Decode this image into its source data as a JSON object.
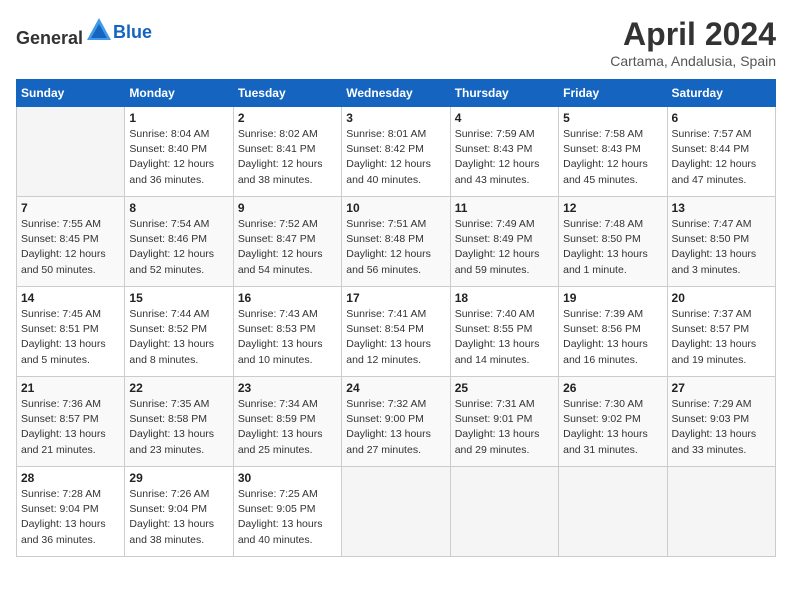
{
  "header": {
    "logo_general": "General",
    "logo_blue": "Blue",
    "month": "April 2024",
    "location": "Cartama, Andalusia, Spain"
  },
  "columns": [
    "Sunday",
    "Monday",
    "Tuesday",
    "Wednesday",
    "Thursday",
    "Friday",
    "Saturday"
  ],
  "weeks": [
    [
      {
        "day": "",
        "info": ""
      },
      {
        "day": "1",
        "info": "Sunrise: 8:04 AM\nSunset: 8:40 PM\nDaylight: 12 hours\nand 36 minutes."
      },
      {
        "day": "2",
        "info": "Sunrise: 8:02 AM\nSunset: 8:41 PM\nDaylight: 12 hours\nand 38 minutes."
      },
      {
        "day": "3",
        "info": "Sunrise: 8:01 AM\nSunset: 8:42 PM\nDaylight: 12 hours\nand 40 minutes."
      },
      {
        "day": "4",
        "info": "Sunrise: 7:59 AM\nSunset: 8:43 PM\nDaylight: 12 hours\nand 43 minutes."
      },
      {
        "day": "5",
        "info": "Sunrise: 7:58 AM\nSunset: 8:43 PM\nDaylight: 12 hours\nand 45 minutes."
      },
      {
        "day": "6",
        "info": "Sunrise: 7:57 AM\nSunset: 8:44 PM\nDaylight: 12 hours\nand 47 minutes."
      }
    ],
    [
      {
        "day": "7",
        "info": "Sunrise: 7:55 AM\nSunset: 8:45 PM\nDaylight: 12 hours\nand 50 minutes."
      },
      {
        "day": "8",
        "info": "Sunrise: 7:54 AM\nSunset: 8:46 PM\nDaylight: 12 hours\nand 52 minutes."
      },
      {
        "day": "9",
        "info": "Sunrise: 7:52 AM\nSunset: 8:47 PM\nDaylight: 12 hours\nand 54 minutes."
      },
      {
        "day": "10",
        "info": "Sunrise: 7:51 AM\nSunset: 8:48 PM\nDaylight: 12 hours\nand 56 minutes."
      },
      {
        "day": "11",
        "info": "Sunrise: 7:49 AM\nSunset: 8:49 PM\nDaylight: 12 hours\nand 59 minutes."
      },
      {
        "day": "12",
        "info": "Sunrise: 7:48 AM\nSunset: 8:50 PM\nDaylight: 13 hours\nand 1 minute."
      },
      {
        "day": "13",
        "info": "Sunrise: 7:47 AM\nSunset: 8:50 PM\nDaylight: 13 hours\nand 3 minutes."
      }
    ],
    [
      {
        "day": "14",
        "info": "Sunrise: 7:45 AM\nSunset: 8:51 PM\nDaylight: 13 hours\nand 5 minutes."
      },
      {
        "day": "15",
        "info": "Sunrise: 7:44 AM\nSunset: 8:52 PM\nDaylight: 13 hours\nand 8 minutes."
      },
      {
        "day": "16",
        "info": "Sunrise: 7:43 AM\nSunset: 8:53 PM\nDaylight: 13 hours\nand 10 minutes."
      },
      {
        "day": "17",
        "info": "Sunrise: 7:41 AM\nSunset: 8:54 PM\nDaylight: 13 hours\nand 12 minutes."
      },
      {
        "day": "18",
        "info": "Sunrise: 7:40 AM\nSunset: 8:55 PM\nDaylight: 13 hours\nand 14 minutes."
      },
      {
        "day": "19",
        "info": "Sunrise: 7:39 AM\nSunset: 8:56 PM\nDaylight: 13 hours\nand 16 minutes."
      },
      {
        "day": "20",
        "info": "Sunrise: 7:37 AM\nSunset: 8:57 PM\nDaylight: 13 hours\nand 19 minutes."
      }
    ],
    [
      {
        "day": "21",
        "info": "Sunrise: 7:36 AM\nSunset: 8:57 PM\nDaylight: 13 hours\nand 21 minutes."
      },
      {
        "day": "22",
        "info": "Sunrise: 7:35 AM\nSunset: 8:58 PM\nDaylight: 13 hours\nand 23 minutes."
      },
      {
        "day": "23",
        "info": "Sunrise: 7:34 AM\nSunset: 8:59 PM\nDaylight: 13 hours\nand 25 minutes."
      },
      {
        "day": "24",
        "info": "Sunrise: 7:32 AM\nSunset: 9:00 PM\nDaylight: 13 hours\nand 27 minutes."
      },
      {
        "day": "25",
        "info": "Sunrise: 7:31 AM\nSunset: 9:01 PM\nDaylight: 13 hours\nand 29 minutes."
      },
      {
        "day": "26",
        "info": "Sunrise: 7:30 AM\nSunset: 9:02 PM\nDaylight: 13 hours\nand 31 minutes."
      },
      {
        "day": "27",
        "info": "Sunrise: 7:29 AM\nSunset: 9:03 PM\nDaylight: 13 hours\nand 33 minutes."
      }
    ],
    [
      {
        "day": "28",
        "info": "Sunrise: 7:28 AM\nSunset: 9:04 PM\nDaylight: 13 hours\nand 36 minutes."
      },
      {
        "day": "29",
        "info": "Sunrise: 7:26 AM\nSunset: 9:04 PM\nDaylight: 13 hours\nand 38 minutes."
      },
      {
        "day": "30",
        "info": "Sunrise: 7:25 AM\nSunset: 9:05 PM\nDaylight: 13 hours\nand 40 minutes."
      },
      {
        "day": "",
        "info": ""
      },
      {
        "day": "",
        "info": ""
      },
      {
        "day": "",
        "info": ""
      },
      {
        "day": "",
        "info": ""
      }
    ]
  ]
}
